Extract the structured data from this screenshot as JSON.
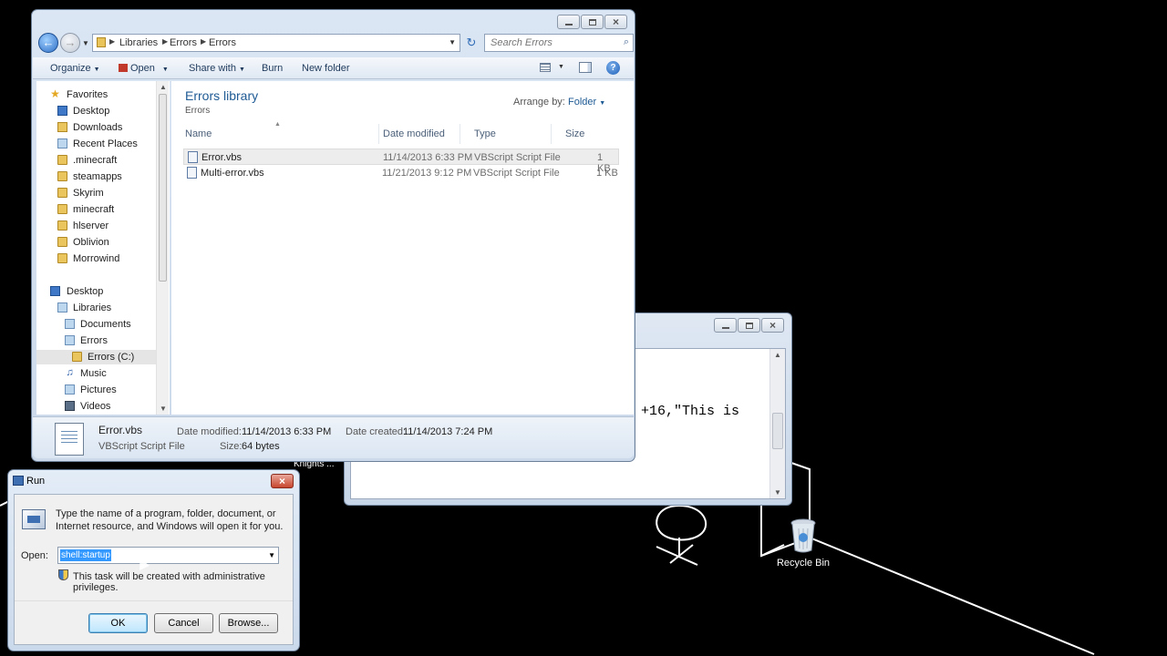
{
  "explorer": {
    "breadcrumb": [
      "Libraries",
      "Errors",
      "Errors"
    ],
    "search_placeholder": "Search Errors",
    "toolbar": {
      "organize": "Organize",
      "open": "Open",
      "share_with": "Share with",
      "burn": "Burn",
      "new_folder": "New folder"
    },
    "nav": {
      "favorites": "Favorites",
      "items": [
        "Desktop",
        "Downloads",
        "Recent Places",
        ".minecraft",
        "steamapps",
        "Skyrim",
        "minecraft",
        "hlserver",
        "Oblivion",
        "Morrowind"
      ],
      "desktop": "Desktop",
      "libraries": "Libraries",
      "documents": "Documents",
      "errors": "Errors",
      "errors_c": "Errors (C:)",
      "music": "Music",
      "pictures": "Pictures",
      "videos": "Videos"
    },
    "library_title": "Errors library",
    "library_subtitle": "Errors",
    "arrange_label": "Arrange by:",
    "arrange_value": "Folder",
    "columns": {
      "name": "Name",
      "date": "Date modified",
      "type": "Type",
      "size": "Size"
    },
    "files": [
      {
        "name": "Error.vbs",
        "date": "11/14/2013 6:33 PM",
        "type": "VBScript Script File",
        "size": "1 KB"
      },
      {
        "name": "Multi-error.vbs",
        "date": "11/21/2013 9:12 PM",
        "type": "VBScript Script File",
        "size": "1 KB"
      }
    ],
    "details": {
      "name": "Error.vbs",
      "type": "VBScript Script File",
      "date_modified_label": "Date modified:",
      "date_modified": "11/14/2013 6:33 PM",
      "date_created_label": "Date created:",
      "date_created": "11/14/2013 7:24 PM",
      "size_label": "Size:",
      "size": "64 bytes"
    }
  },
  "notepad": {
    "text_fragment": "+16,\"This is"
  },
  "run": {
    "title": "Run",
    "description": "Type the name of a program, folder, document, or Internet resource, and Windows will open it for you.",
    "open_label": "Open:",
    "input_value": "shell:startup",
    "admin_note": "This task will be created with administrative privileges.",
    "ok": "OK",
    "cancel": "Cancel",
    "browse": "Browse..."
  },
  "desktop": {
    "recycle_bin": "Recycle Bin",
    "partial_label": "Knights ..."
  }
}
